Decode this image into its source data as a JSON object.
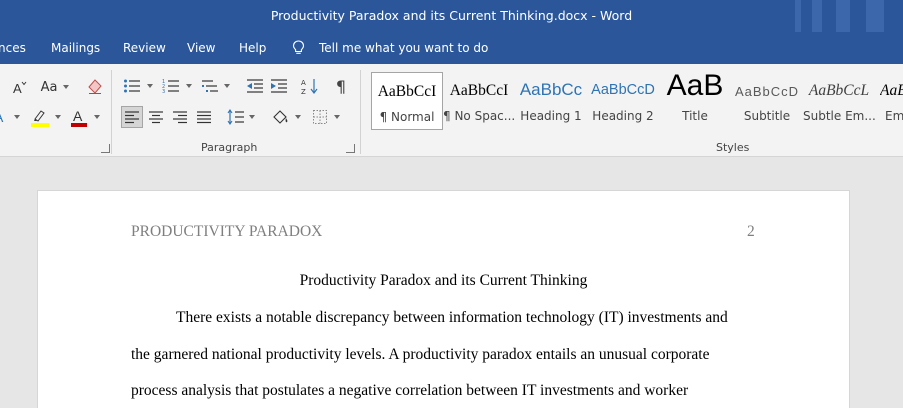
{
  "window": {
    "title": "Productivity Paradox and its Current Thinking.docx  -  Word"
  },
  "tabs": [
    {
      "label": "nces"
    },
    {
      "label": "Mailings"
    },
    {
      "label": "Review"
    },
    {
      "label": "View"
    },
    {
      "label": "Help"
    }
  ],
  "tell_me": {
    "icon": "lightbulb-icon",
    "label": "Tell me what you want to do"
  },
  "ribbon": {
    "font_group": {
      "change_case_label": "Aa"
    },
    "paragraph_label": "Paragraph",
    "styles_label": "Styles",
    "styles": [
      {
        "preview": "AaBbCcI",
        "name": "¶ Normal",
        "selected": true
      },
      {
        "preview": "AaBbCcI",
        "name": "¶ No Spac..."
      },
      {
        "preview": "AaBbCc",
        "name": "Heading 1"
      },
      {
        "preview": "AaBbCcD",
        "name": "Heading 2"
      },
      {
        "preview": "AaB",
        "name": "Title"
      },
      {
        "preview": "AaBbCcD",
        "name": "Subtitle"
      },
      {
        "preview": "AaBbCcL",
        "name": "Subtle Em..."
      },
      {
        "preview": "AaB",
        "name": "Em"
      }
    ]
  },
  "document": {
    "running_head": "PRODUCTIVITY PARADOX",
    "page_number": "2",
    "title": "Productivity Paradox and its Current Thinking",
    "lines": [
      "There exists a notable discrepancy between information technology (IT) investments and",
      "the garnered national productivity levels. A productivity paradox entails an unusual corporate",
      "process analysis that postulates a negative correlation between IT investments and worker"
    ]
  },
  "colors": {
    "ribbon_blue": "#2b579a",
    "ribbon_bg": "#f3f3f3",
    "canvas_bg": "#e6e6e6",
    "highlight_yellow": "#ffff00",
    "font_color_red": "#c00000",
    "heading_blue": "#2e74b5"
  }
}
